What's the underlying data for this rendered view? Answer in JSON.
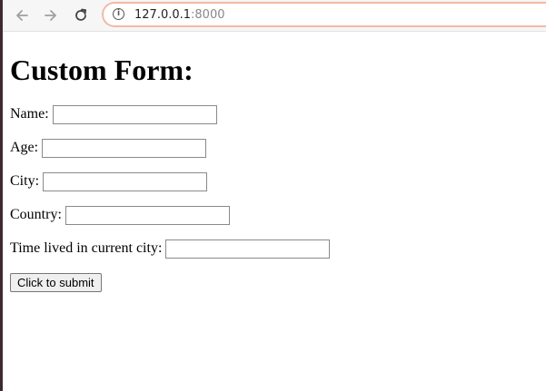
{
  "browser": {
    "url_host": "127.0.0.1",
    "url_port": ":8000",
    "icons": {
      "back": "arrow-left-icon",
      "forward": "arrow-right-icon",
      "reload": "reload-icon",
      "site_info": "info-icon"
    },
    "focus_ring_color": "#f3b9a4"
  },
  "form": {
    "title": "Custom Form:",
    "fields": [
      {
        "label": "Name:",
        "value": ""
      },
      {
        "label": "Age:",
        "value": ""
      },
      {
        "label": "City:",
        "value": ""
      },
      {
        "label": "Country:",
        "value": ""
      },
      {
        "label": "Time lived in current city:",
        "value": ""
      }
    ],
    "submit_label": "Click to submit"
  }
}
